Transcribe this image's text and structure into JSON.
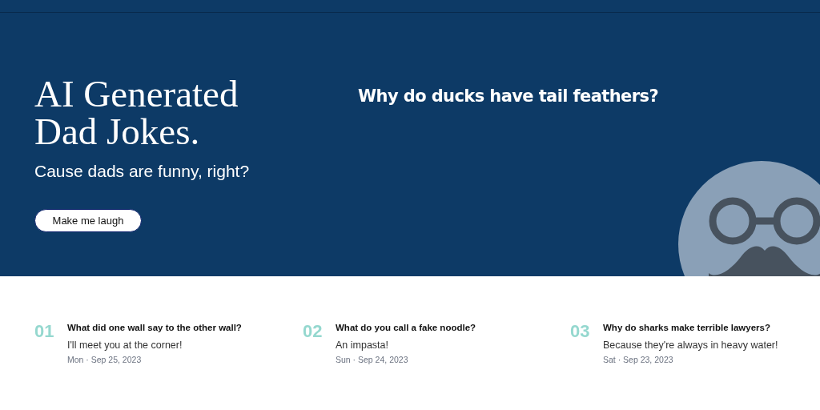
{
  "hero": {
    "title": "AI Generated Dad Jokes.",
    "subtitle": "Cause dads are funny, right?",
    "button": "Make me laugh",
    "joke": "Why do ducks have tail feathers?"
  },
  "jokes": [
    {
      "number": "01",
      "question": "What did one wall say to the other wall?",
      "answer": "I'll meet you at the corner!",
      "date": "Mon · Sep 25, 2023"
    },
    {
      "number": "02",
      "question": "What do you call a fake noodle?",
      "answer": "An impasta!",
      "date": "Sun · Sep 24, 2023"
    },
    {
      "number": "03",
      "question": "Why do sharks make terrible lawyers?",
      "answer": "Because they're always in heavy water!",
      "date": "Sat · Sep 23, 2023"
    }
  ]
}
